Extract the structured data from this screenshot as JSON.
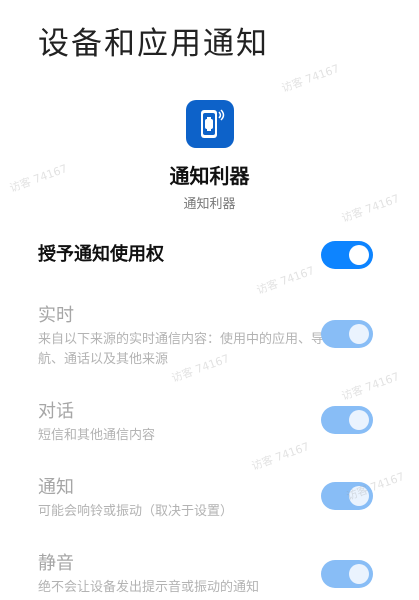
{
  "page": {
    "title": "设备和应用通知"
  },
  "app": {
    "name": "通知利器",
    "subtitle": "通知利器",
    "icon": "smartwatch-notification-icon",
    "icon_color": "#0d62c9"
  },
  "grant": {
    "label": "授予通知使用权",
    "enabled": true
  },
  "settings": [
    {
      "title": "实时",
      "description": "来自以下来源的实时通信内容：使用中的应用、导航、通话以及其他来源",
      "enabled": true
    },
    {
      "title": "对话",
      "description": "短信和其他通信内容",
      "enabled": true
    },
    {
      "title": "通知",
      "description": "可能会响铃或振动（取决于设置）",
      "enabled": true
    },
    {
      "title": "静音",
      "description": "绝不会让设备发出提示音或振动的通知",
      "enabled": true
    }
  ],
  "watermark": {
    "text": "访客 74167"
  },
  "colors": {
    "toggle_on": "#0d84ff",
    "toggle_on_disabled": "#88bdf6"
  }
}
